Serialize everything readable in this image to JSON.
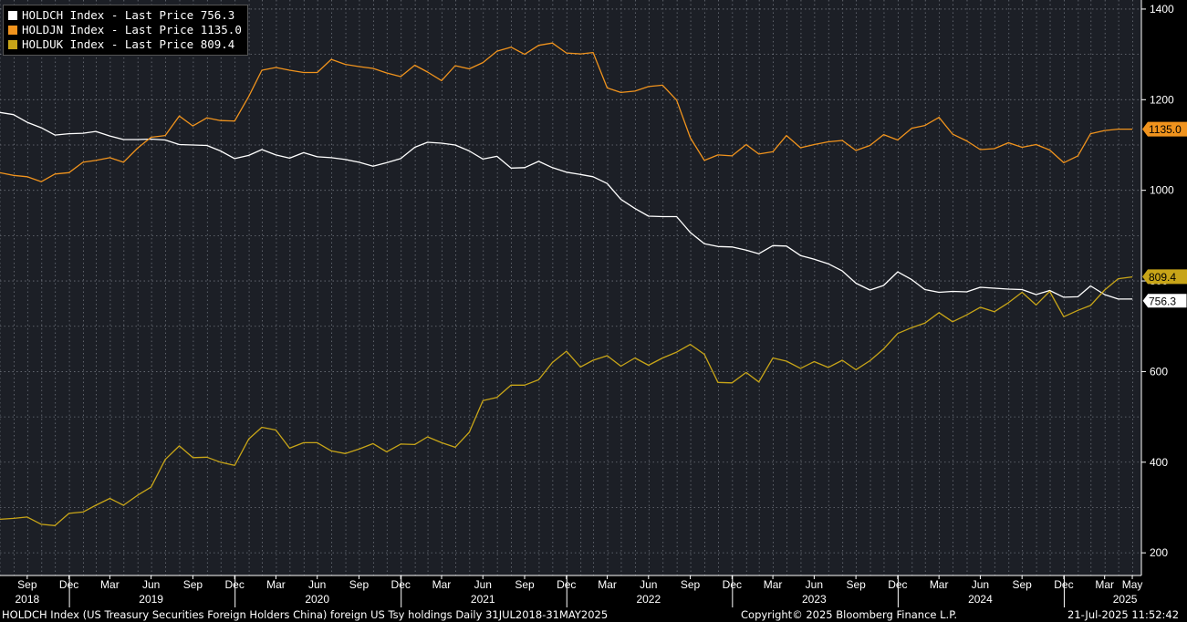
{
  "chart_data": {
    "type": "line",
    "title": "",
    "xlabel": "",
    "ylabel": "",
    "ylim": [
      150,
      1420
    ],
    "y_ticks": [
      200,
      400,
      600,
      800,
      1000,
      1200,
      1400
    ],
    "x_range": [
      "2018-08-01",
      "2025-06-20"
    ],
    "x_tick_months": [
      {
        "label": "Sep",
        "date": "2018-09-30"
      },
      {
        "label": "Dec",
        "date": "2018-12-31"
      },
      {
        "label": "Mar",
        "date": "2019-03-31"
      },
      {
        "label": "Jun",
        "date": "2019-06-30"
      },
      {
        "label": "Sep",
        "date": "2019-09-30"
      },
      {
        "label": "Dec",
        "date": "2019-12-31"
      },
      {
        "label": "Mar",
        "date": "2020-03-31"
      },
      {
        "label": "Jun",
        "date": "2020-06-30"
      },
      {
        "label": "Sep",
        "date": "2020-09-30"
      },
      {
        "label": "Dec",
        "date": "2020-12-31"
      },
      {
        "label": "Mar",
        "date": "2021-03-31"
      },
      {
        "label": "Jun",
        "date": "2021-06-30"
      },
      {
        "label": "Sep",
        "date": "2021-09-30"
      },
      {
        "label": "Dec",
        "date": "2021-12-31"
      },
      {
        "label": "Mar",
        "date": "2022-03-31"
      },
      {
        "label": "Jun",
        "date": "2022-06-30"
      },
      {
        "label": "Sep",
        "date": "2022-09-30"
      },
      {
        "label": "Dec",
        "date": "2022-12-31"
      },
      {
        "label": "Mar",
        "date": "2023-03-31"
      },
      {
        "label": "Jun",
        "date": "2023-06-30"
      },
      {
        "label": "Sep",
        "date": "2023-09-30"
      },
      {
        "label": "Dec",
        "date": "2023-12-31"
      },
      {
        "label": "Mar",
        "date": "2024-03-31"
      },
      {
        "label": "Jun",
        "date": "2024-06-30"
      },
      {
        "label": "Sep",
        "date": "2024-09-30"
      },
      {
        "label": "Dec",
        "date": "2024-12-31"
      },
      {
        "label": "Mar",
        "date": "2025-03-31"
      },
      {
        "label": "May",
        "date": "2025-05-31"
      }
    ],
    "x_tick_years": [
      {
        "label": "2018",
        "date": "2018-09-30"
      },
      {
        "label": "2019",
        "date": "2019-06-30"
      },
      {
        "label": "2020",
        "date": "2020-06-30"
      },
      {
        "label": "2021",
        "date": "2021-06-30"
      },
      {
        "label": "2022",
        "date": "2022-06-30"
      },
      {
        "label": "2023",
        "date": "2023-06-30"
      },
      {
        "label": "2024",
        "date": "2024-06-30"
      },
      {
        "label": "2025",
        "date": "2025-05-15"
      }
    ],
    "x_dates": [
      "2018-07-31",
      "2018-08-31",
      "2018-09-30",
      "2018-10-31",
      "2018-11-30",
      "2018-12-31",
      "2019-01-31",
      "2019-02-28",
      "2019-03-31",
      "2019-04-30",
      "2019-05-31",
      "2019-06-30",
      "2019-07-31",
      "2019-08-31",
      "2019-09-30",
      "2019-10-31",
      "2019-11-30",
      "2019-12-31",
      "2020-01-31",
      "2020-02-29",
      "2020-03-31",
      "2020-04-30",
      "2020-05-31",
      "2020-06-30",
      "2020-07-31",
      "2020-08-31",
      "2020-09-30",
      "2020-10-31",
      "2020-11-30",
      "2020-12-31",
      "2021-01-31",
      "2021-02-28",
      "2021-03-31",
      "2021-04-30",
      "2021-05-31",
      "2021-06-30",
      "2021-07-31",
      "2021-08-31",
      "2021-09-30",
      "2021-10-31",
      "2021-11-30",
      "2021-12-31",
      "2022-01-31",
      "2022-02-28",
      "2022-03-31",
      "2022-04-30",
      "2022-05-31",
      "2022-06-30",
      "2022-07-31",
      "2022-08-31",
      "2022-09-30",
      "2022-10-31",
      "2022-11-30",
      "2022-12-31",
      "2023-01-31",
      "2023-02-28",
      "2023-03-31",
      "2023-04-30",
      "2023-05-31",
      "2023-06-30",
      "2023-07-31",
      "2023-08-31",
      "2023-09-30",
      "2023-10-31",
      "2023-11-30",
      "2023-12-31",
      "2024-01-31",
      "2024-02-29",
      "2024-03-31",
      "2024-04-30",
      "2024-05-31",
      "2024-06-30",
      "2024-07-31",
      "2024-08-31",
      "2024-09-30",
      "2024-10-31",
      "2024-11-30",
      "2024-12-31",
      "2025-01-31",
      "2025-02-28",
      "2025-03-31",
      "2025-04-30",
      "2025-05-31"
    ],
    "series": [
      {
        "name": "HOLDCH Index - Last Price 756.3",
        "ticker": "HOLDCH Index",
        "last_label": "Last Price",
        "last": "756.3",
        "color": "#ffffff",
        "values": [
          1172,
          1167,
          1150,
          1138,
          1122,
          1125,
          1126,
          1130,
          1120,
          1112,
          1112,
          1113,
          1111,
          1101,
          1100,
          1099,
          1087,
          1070,
          1077,
          1090,
          1078,
          1071,
          1083,
          1074,
          1072,
          1068,
          1062,
          1053,
          1061,
          1070,
          1095,
          1106,
          1104,
          1100,
          1087,
          1069,
          1075,
          1049,
          1050,
          1064,
          1050,
          1040,
          1035,
          1030,
          1015,
          980,
          960,
          943,
          942,
          942,
          907,
          882,
          876,
          875,
          868,
          860,
          878,
          877,
          856,
          848,
          838,
          822,
          795,
          780,
          790,
          820,
          803,
          781,
          775,
          777,
          776,
          786,
          784,
          782,
          781,
          770,
          779,
          764,
          765,
          789,
          770,
          760,
          760
        ]
      },
      {
        "name": "HOLDJN Index - Last Price 1135.0",
        "ticker": "HOLDJN Index",
        "last_label": "Last Price",
        "last": "1135.0",
        "color": "#f0931d",
        "values": [
          1039,
          1033,
          1030,
          1019,
          1036,
          1039,
          1062,
          1066,
          1072,
          1062,
          1093,
          1117,
          1121,
          1164,
          1142,
          1160,
          1154,
          1153,
          1207,
          1265,
          1271,
          1265,
          1260,
          1260,
          1289,
          1278,
          1273,
          1269,
          1259,
          1251,
          1276,
          1261,
          1242,
          1275,
          1268,
          1282,
          1307,
          1316,
          1300,
          1320,
          1325,
          1303,
          1301,
          1304,
          1226,
          1216,
          1219,
          1229,
          1232,
          1199,
          1116,
          1066,
          1078,
          1076,
          1101,
          1080,
          1085,
          1121,
          1094,
          1101,
          1107,
          1110,
          1088,
          1099,
          1123,
          1111,
          1137,
          1143,
          1161,
          1124,
          1109,
          1090,
          1092,
          1105,
          1095,
          1101,
          1089,
          1061,
          1076,
          1125,
          1132,
          1135,
          1135
        ]
      },
      {
        "name": "HOLDUK Index - Last Price 809.4",
        "ticker": "HOLDUK Index",
        "last_label": "Last Price",
        "last": "809.4",
        "color": "#c8a518",
        "values": [
          274,
          276,
          279,
          263,
          260,
          287,
          290,
          305,
          320,
          305,
          327,
          345,
          406,
          436,
          410,
          411,
          400,
          393,
          451,
          477,
          471,
          431,
          443,
          443,
          425,
          419,
          429,
          441,
          423,
          440,
          439,
          456,
          443,
          433,
          466,
          536,
          543,
          570,
          570,
          582,
          620,
          645,
          610,
          625,
          635,
          612,
          630,
          614,
          630,
          643,
          660,
          638,
          576,
          575,
          598,
          577,
          630,
          623,
          607,
          622,
          609,
          625,
          604,
          624,
          650,
          684,
          697,
          707,
          730,
          710,
          725,
          742,
          732,
          752,
          775,
          747,
          777,
          721,
          735,
          746,
          780,
          805,
          809
        ]
      }
    ],
    "grid": true,
    "legend_placement": "top-left"
  },
  "footer": {
    "description": "HOLDCH Index (US Treasury Securities Foreign Holders China) foreign US Tsy holdings  Daily 31JUL2018-31MAY2025",
    "copyright": "Copyright© 2025 Bloomberg Finance L.P.",
    "timestamp": "21-Jul-2025 11:52:42"
  },
  "colors": {
    "background": "#1c1f26",
    "grid": "#8a8f99",
    "axis_text": "#ffffff",
    "label_box_bg": "#ffffff",
    "label_box_text": "#000000"
  }
}
